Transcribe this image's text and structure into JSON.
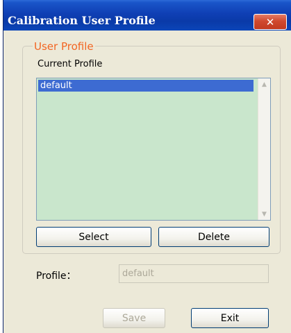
{
  "window": {
    "title": "Calibration User Profile",
    "close_label": "✕"
  },
  "group": {
    "title": "User Profile",
    "list_label": "Current Profile",
    "items": [
      "default"
    ],
    "scroll_up": "▲",
    "scroll_down": "▼"
  },
  "buttons": {
    "select": "Select",
    "delete": "Delete",
    "save": "Save",
    "exit": "Exit"
  },
  "profile": {
    "label": "Profile：",
    "value": "default"
  },
  "colors": {
    "accent": "#f26522",
    "selection": "#3d6bd2",
    "list_bg": "#c9e6cc"
  }
}
